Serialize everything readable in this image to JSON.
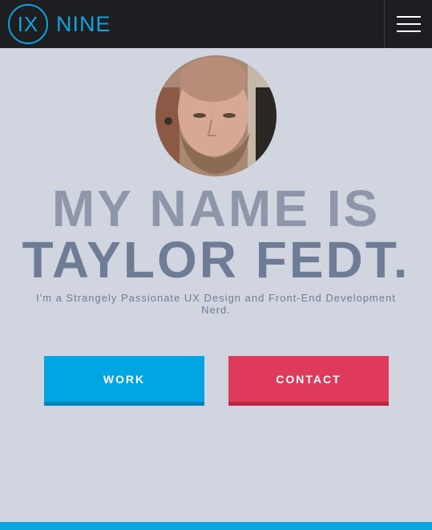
{
  "brand": {
    "mark": "IX",
    "word": "NINE"
  },
  "nav": {
    "menu_icon": "hamburger-menu-icon"
  },
  "profile": {
    "avatar_alt": "Profile photo"
  },
  "hero": {
    "line1": "MY NAME IS",
    "line2": "TAYLOR FEDT.",
    "tagline": "I'm a Strangely Passionate UX Design and Front-End Development Nerd."
  },
  "buttons": {
    "work": "WORK",
    "contact": "CONTACT"
  },
  "colors": {
    "topbar": "#1c1e21",
    "background": "#d0d5df",
    "brand": "#0ea5de",
    "work": "#00a6e3",
    "contact": "#df3a5b"
  }
}
